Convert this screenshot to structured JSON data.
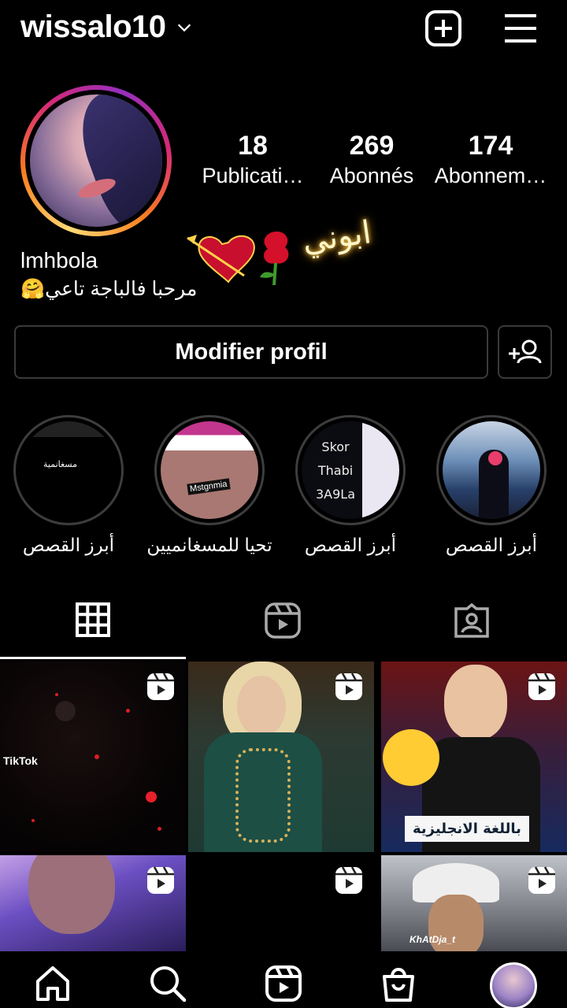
{
  "header": {
    "username": "wissalo10"
  },
  "profile": {
    "stats": [
      {
        "count": "18",
        "label": "Publicati…"
      },
      {
        "count": "269",
        "label": "Abonnés"
      },
      {
        "count": "174",
        "label": "Abonnem…"
      }
    ],
    "full_name": "lmhbola",
    "bio": "مرحبا فالباجة تاعي🤗",
    "sticker_text": "ابوني",
    "edit_button_label": "Modifier profil"
  },
  "highlights": [
    {
      "label": "أبرز القصص",
      "caption": "مسغانمية"
    },
    {
      "label": "تحيا للمسغانميين",
      "caption": "Mstgnmia"
    },
    {
      "label": "أبرز القصص",
      "lines": [
        "Skor",
        "Thabi",
        "3A9La"
      ]
    },
    {
      "label": "أبرز القصص"
    }
  ],
  "posts": [
    {
      "type": "reel",
      "watermark": "TikTok"
    },
    {
      "type": "reel"
    },
    {
      "type": "reel",
      "caption": "باللغة الانجليزية"
    },
    {
      "type": "reel"
    },
    {
      "type": "reel"
    },
    {
      "type": "reel",
      "watermark": "KhAtDja_t"
    }
  ],
  "colors": {
    "background": "#000000",
    "text": "#ffffff",
    "border": "#3a3a3a",
    "story_ring": [
      "#feda75",
      "#fa7e1e",
      "#d62976",
      "#962fbf"
    ]
  },
  "icons": [
    "chevron-down-icon",
    "add-post-icon",
    "hamburger-menu-icon",
    "add-person-icon",
    "grid-icon",
    "reels-icon",
    "tagged-icon",
    "home-icon",
    "search-icon",
    "shop-icon"
  ]
}
